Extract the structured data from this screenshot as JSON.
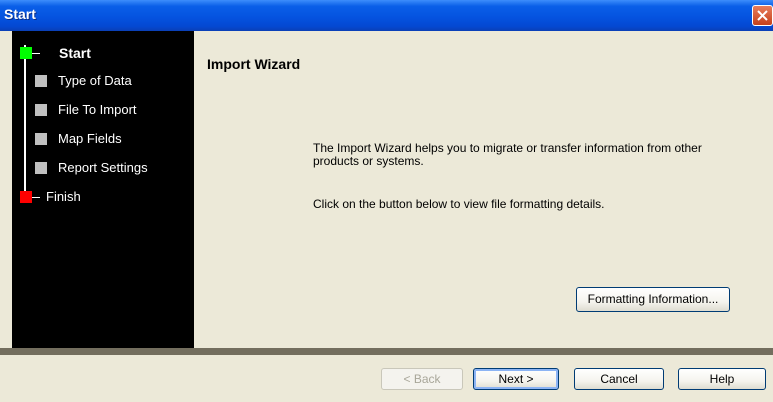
{
  "window": {
    "title": "Start"
  },
  "steps": [
    {
      "label": "Start",
      "state": "active",
      "marker_color": "#00ff00"
    },
    {
      "label": "Type of Data",
      "state": "pending",
      "marker_color": "#c0c0c0"
    },
    {
      "label": "File To Import",
      "state": "pending",
      "marker_color": "#c0c0c0"
    },
    {
      "label": "Map Fields",
      "state": "pending",
      "marker_color": "#c0c0c0"
    },
    {
      "label": "Report Settings",
      "state": "pending",
      "marker_color": "#c0c0c0"
    },
    {
      "label": "Finish",
      "state": "final",
      "marker_color": "#ff0000"
    }
  ],
  "main": {
    "heading": "Import Wizard",
    "description": "The Import Wizard helps you to migrate or transfer information from other products or systems.",
    "instruction": "Click on the button below to view file formatting details.",
    "formatting_button": "Formatting Information..."
  },
  "footer": {
    "back_label": "< Back",
    "next_label": "Next >",
    "cancel_label": "Cancel",
    "help_label": "Help"
  }
}
